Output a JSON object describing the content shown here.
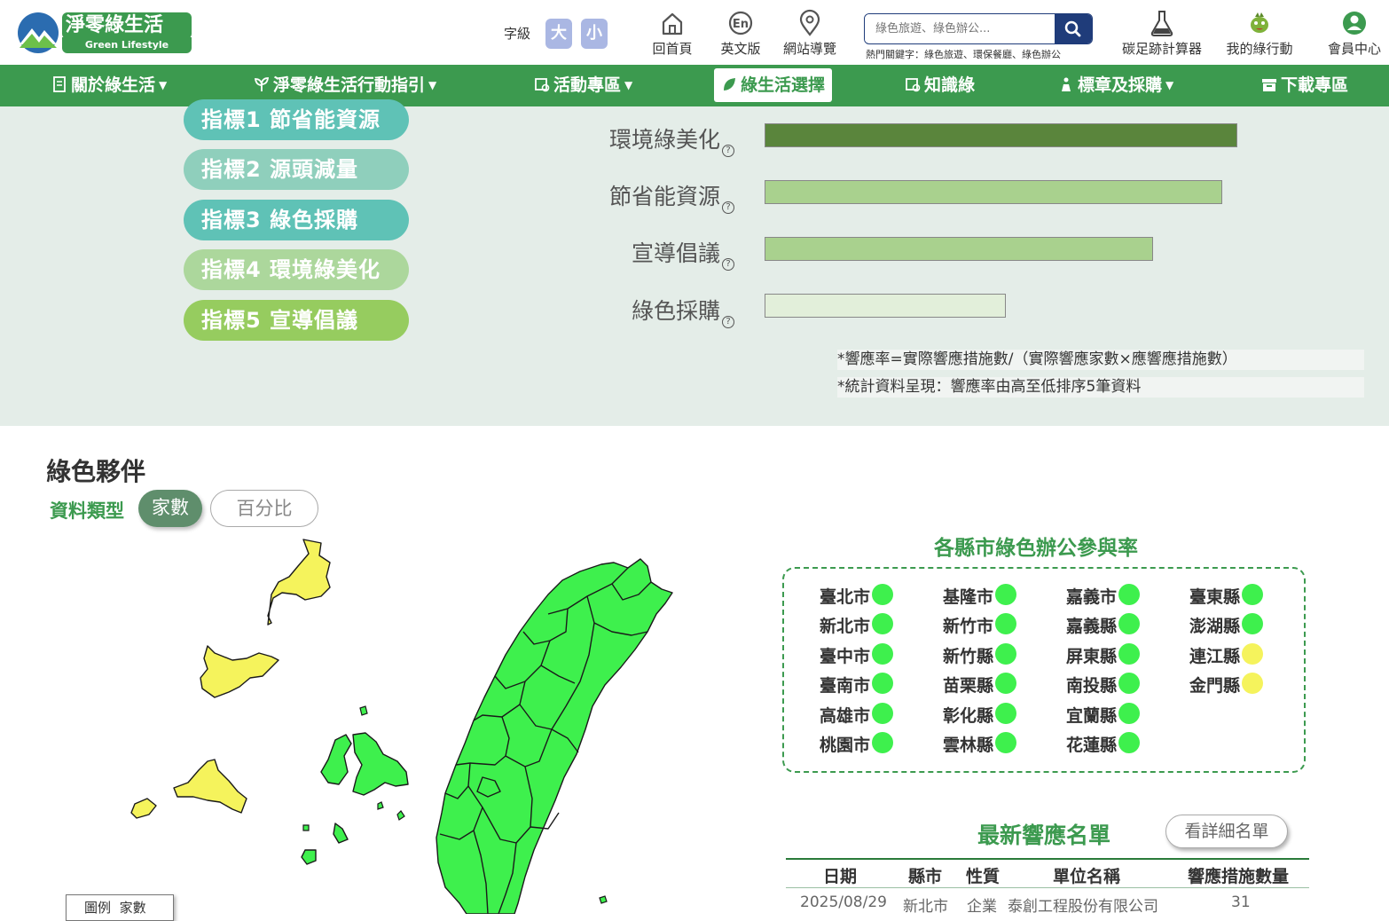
{
  "header": {
    "logo_title": "淨零綠生活",
    "logo_subtitle": "Green Lifestyle",
    "font_size_label": "字級",
    "font_large": "大",
    "font_small": "小",
    "tools": [
      {
        "label": "回首頁",
        "icon": "home-icon"
      },
      {
        "label": "英文版",
        "icon": "english-icon"
      },
      {
        "label": "網站導覽",
        "icon": "location-pin-icon"
      }
    ],
    "search_placeholder": "綠色旅遊、綠色辦公...",
    "hot_keywords": "熱門關鍵字：綠色旅遊、環保餐廳、綠色辦公",
    "right_tools": [
      {
        "label": "碳足跡計算器",
        "icon": "flask-icon"
      },
      {
        "label": "我的綠行動",
        "icon": "mascot-icon"
      },
      {
        "label": "會員中心",
        "icon": "user-icon"
      }
    ]
  },
  "nav": {
    "items": [
      {
        "label": "關於綠生活",
        "has_caret": true
      },
      {
        "label": "淨零綠生活行動指引",
        "has_caret": true
      },
      {
        "label": "活動專區",
        "has_caret": true
      },
      {
        "label": "綠生活選擇",
        "has_caret": false,
        "active": true
      },
      {
        "label": "知識綠",
        "has_caret": false
      },
      {
        "label": "標章及採購",
        "has_caret": true
      },
      {
        "label": "下載專區",
        "has_caret": false
      }
    ]
  },
  "indicators": {
    "pills": [
      {
        "label": "指標1 節省能資源",
        "color": "#5fc2b6"
      },
      {
        "label": "指標2 源頭減量",
        "color": "#8fcfbc"
      },
      {
        "label": "指標3 綠色採購",
        "color": "#5fc2b6"
      },
      {
        "label": "指標4 環境綠美化",
        "color": "#acd79c"
      },
      {
        "label": "指標5 宣導倡議",
        "color": "#96cc5f"
      }
    ],
    "bars": [
      {
        "label": "環境綠美化",
        "value": 0.96,
        "color": "#5a853c"
      },
      {
        "label": "節省能資源",
        "value": 0.93,
        "color": "#a9d18e"
      },
      {
        "label": "宣導倡議",
        "value": 0.79,
        "color": "#a9d18e"
      },
      {
        "label": "綠色採購",
        "value": 0.49,
        "color": "#e2efda"
      }
    ],
    "notes": [
      "*響應率=實際響應措施數/（實際響應家數×應響應措施數）",
      "*統計資料呈現：響應率由高至低排序5筆資料"
    ]
  },
  "partners": {
    "title": "綠色夥伴",
    "data_type_label": "資料類型",
    "data_type_active": "家數",
    "data_type_other": "百分比",
    "legend_label": "圖例",
    "legend_value": "家數",
    "county_title": "各縣市綠色辦公參與率",
    "county_columns": [
      [
        {
          "name": "臺北市",
          "color": "#3ef04d"
        },
        {
          "name": "新北市",
          "color": "#3ef04d"
        },
        {
          "name": "臺中市",
          "color": "#3ef04d"
        },
        {
          "name": "臺南市",
          "color": "#3ef04d"
        },
        {
          "name": "高雄市",
          "color": "#3ef04d"
        },
        {
          "name": "桃園市",
          "color": "#3ef04d"
        }
      ],
      [
        {
          "name": "基隆市",
          "color": "#3ef04d"
        },
        {
          "name": "新竹市",
          "color": "#3ef04d"
        },
        {
          "name": "新竹縣",
          "color": "#3ef04d"
        },
        {
          "name": "苗栗縣",
          "color": "#3ef04d"
        },
        {
          "name": "彰化縣",
          "color": "#3ef04d"
        },
        {
          "name": "雲林縣",
          "color": "#3ef04d"
        }
      ],
      [
        {
          "name": "嘉義市",
          "color": "#3ef04d"
        },
        {
          "name": "嘉義縣",
          "color": "#3ef04d"
        },
        {
          "name": "屏東縣",
          "color": "#3ef04d"
        },
        {
          "name": "南投縣",
          "color": "#3ef04d"
        },
        {
          "name": "宜蘭縣",
          "color": "#3ef04d"
        },
        {
          "name": "花蓮縣",
          "color": "#3ef04d"
        }
      ],
      [
        {
          "name": "臺東縣",
          "color": "#3ef04d"
        },
        {
          "name": "澎湖縣",
          "color": "#3ef04d"
        },
        {
          "name": "連江縣",
          "color": "#f5f35c"
        },
        {
          "name": "金門縣",
          "color": "#f5f35c"
        }
      ]
    ],
    "latest_title": "最新響應名單",
    "detail_button": "看詳細名單",
    "table": {
      "headers": [
        "日期",
        "縣市",
        "性質",
        "單位名稱",
        "響應措施數量"
      ],
      "rows": [
        [
          "2025/08/29",
          "新北市",
          "企業",
          "泰創工程股份有限公司",
          "31"
        ]
      ]
    }
  },
  "colors": {
    "brand_green": "#3c9a4f",
    "map_green": "#3ef04d",
    "map_yellow": "#f5f35c"
  }
}
